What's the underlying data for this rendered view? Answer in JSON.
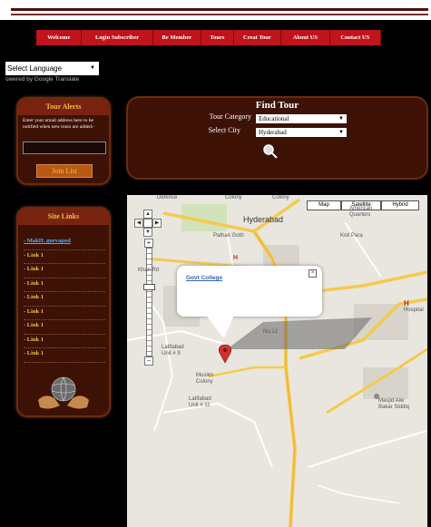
{
  "nav": {
    "items": [
      "Welcome",
      "Login Subscriber",
      "Be Member",
      "Tours",
      "Creat Tour",
      "About US",
      "Contact US"
    ]
  },
  "language": {
    "select_value": "Select Language",
    "powered_by": "owered by Google Translate"
  },
  "alerts": {
    "title": "Tour Alerts",
    "description": "Enter your email address here to be notified when new tours are added:-",
    "join_label": "Join List"
  },
  "site_links": {
    "title": "Site Links",
    "items": [
      "MakH. guevapod",
      "Link 1",
      "Link 1",
      "Link 1",
      "Link 1",
      "Link 1",
      "Link 1",
      "Link 1",
      "Link 1"
    ]
  },
  "find_tour": {
    "title": "Find Tour",
    "category_label": "Tour Category",
    "category_value": "Educational",
    "city_label": "Select City",
    "city_value": "Hyderabad"
  },
  "map": {
    "types": [
      "Map",
      "Satellite",
      "Hybrid"
    ],
    "info_title": "Govt College",
    "labels": {
      "hyderabad": "Hyderabad",
      "defence": "Defence",
      "colony1": "Colony",
      "colony2": "Colony",
      "kotpara": "Koti Para",
      "pathan": "Pathan Goth",
      "american": "American Quarters",
      "latifabad9": "Latifabad Unit # 9",
      "latifabad11": "Latifabad Unit # 11",
      "muslim": "Muslim Colony",
      "khan": "Khan Rd",
      "masjid": "Masjid Aiw Bakar Siddiq",
      "no12": "No.12",
      "hospital": "Hospital",
      "hrd": "H"
    },
    "colors": {
      "road_major": "#f6c94d",
      "road_minor": "#ffffff",
      "park": "#c8dfa8",
      "bg": "#e9e6df"
    }
  },
  "colors": {
    "nav_red": "#c0141c",
    "panel_brown": "#3d1205",
    "gold": "#f0c040"
  }
}
